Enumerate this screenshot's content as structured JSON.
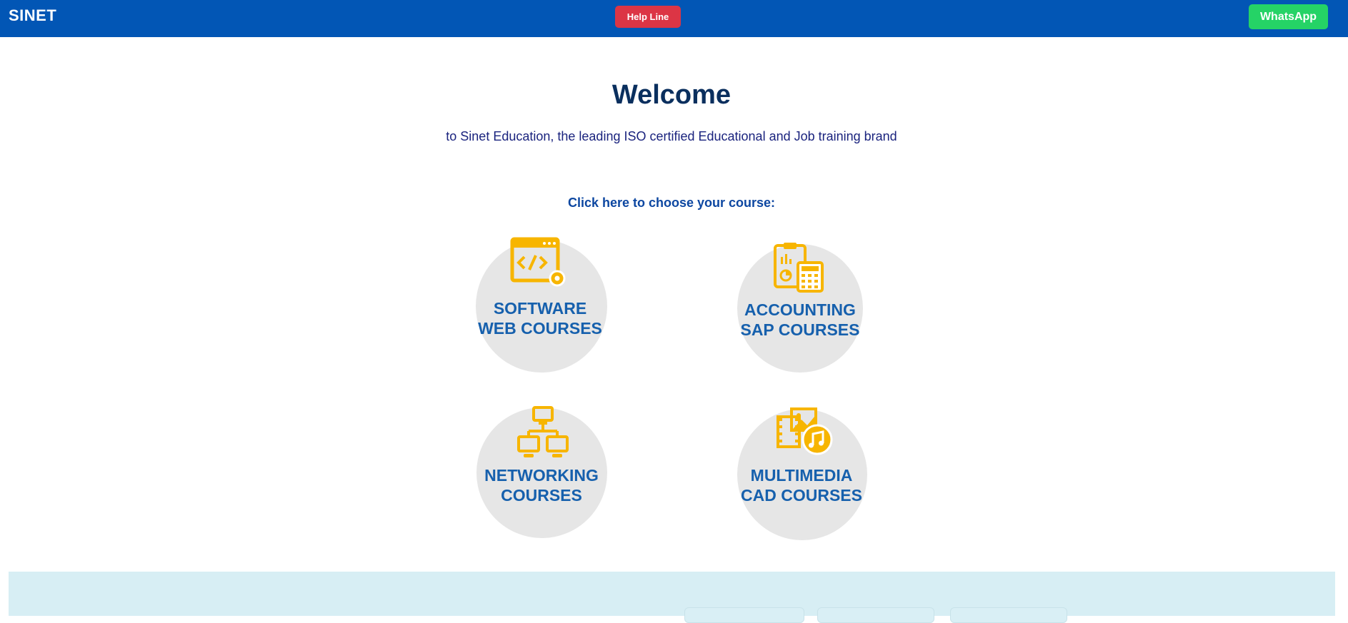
{
  "header": {
    "brand": "SINET",
    "helpline_label": "Help Line",
    "whatsapp_label": "WhatsApp",
    "colors": {
      "bar": "#0256b5",
      "helpline": "#dc3545",
      "whatsapp": "#25d366"
    }
  },
  "hero": {
    "title": "Welcome",
    "tagline": "to Sinet Education, the leading ISO certified Educational and Job training brand"
  },
  "courses": {
    "prompt": "Click here to choose your course:",
    "items": [
      {
        "line1": "SOFTWARE",
        "line2": "WEB COURSES",
        "icon": "code-window-gear-icon"
      },
      {
        "line1": "ACCOUNTING",
        "line2": "SAP COURSES",
        "icon": "clipboard-calculator-icon"
      },
      {
        "line1": "NETWORKING",
        "line2": "COURSES",
        "icon": "network-computers-icon"
      },
      {
        "line1": "MULTIMEDIA",
        "line2": "CAD COURSES",
        "icon": "media-film-music-icon"
      }
    ],
    "colors": {
      "icon": "#f7b500",
      "label": "#1660ad",
      "circle": "#e6e6e6"
    }
  }
}
